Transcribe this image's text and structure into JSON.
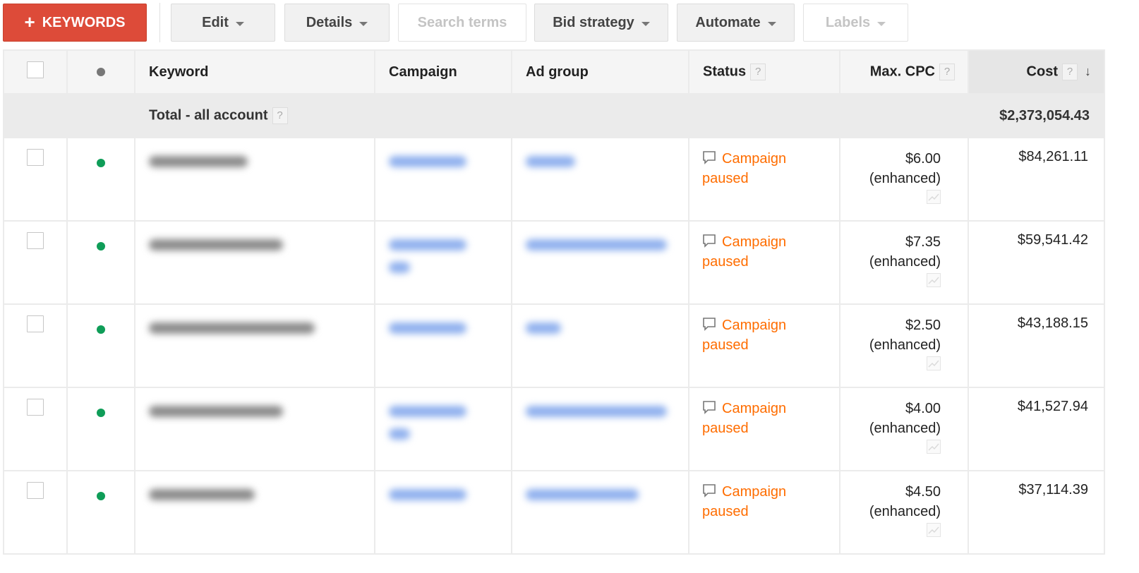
{
  "toolbar": {
    "add_keywords": "KEYWORDS",
    "edit": "Edit",
    "details": "Details",
    "search_terms": "Search terms",
    "bid_strategy": "Bid strategy",
    "automate": "Automate",
    "labels": "Labels"
  },
  "table": {
    "columns": {
      "keyword": "Keyword",
      "campaign": "Campaign",
      "ad_group": "Ad group",
      "status": "Status",
      "max_cpc": "Max. CPC",
      "cost": "Cost"
    },
    "help_glyph": "?",
    "sort_glyph": "↓",
    "total": {
      "label": "Total - all account",
      "cost": "$2,373,054.43"
    },
    "rows": [
      {
        "status_line1": "Campaign",
        "status_line2": "paused",
        "max_cpc": "$6.00",
        "cpc_note": "(enhanced)",
        "cost": "$84,261.11"
      },
      {
        "status_line1": "Campaign",
        "status_line2": "paused",
        "max_cpc": "$7.35",
        "cpc_note": "(enhanced)",
        "cost": "$59,541.42"
      },
      {
        "status_line1": "Campaign",
        "status_line2": "paused",
        "max_cpc": "$2.50",
        "cpc_note": "(enhanced)",
        "cost": "$43,188.15"
      },
      {
        "status_line1": "Campaign",
        "status_line2": "paused",
        "max_cpc": "$4.00",
        "cpc_note": "(enhanced)",
        "cost": "$41,527.94"
      },
      {
        "status_line1": "Campaign",
        "status_line2": "paused",
        "max_cpc": "$4.50",
        "cpc_note": "(enhanced)",
        "cost": "$37,114.39"
      }
    ]
  },
  "colors": {
    "primary_button": "#dd4b39",
    "status_paused": "#ff6d00",
    "enabled_dot": "#0f9d58"
  }
}
